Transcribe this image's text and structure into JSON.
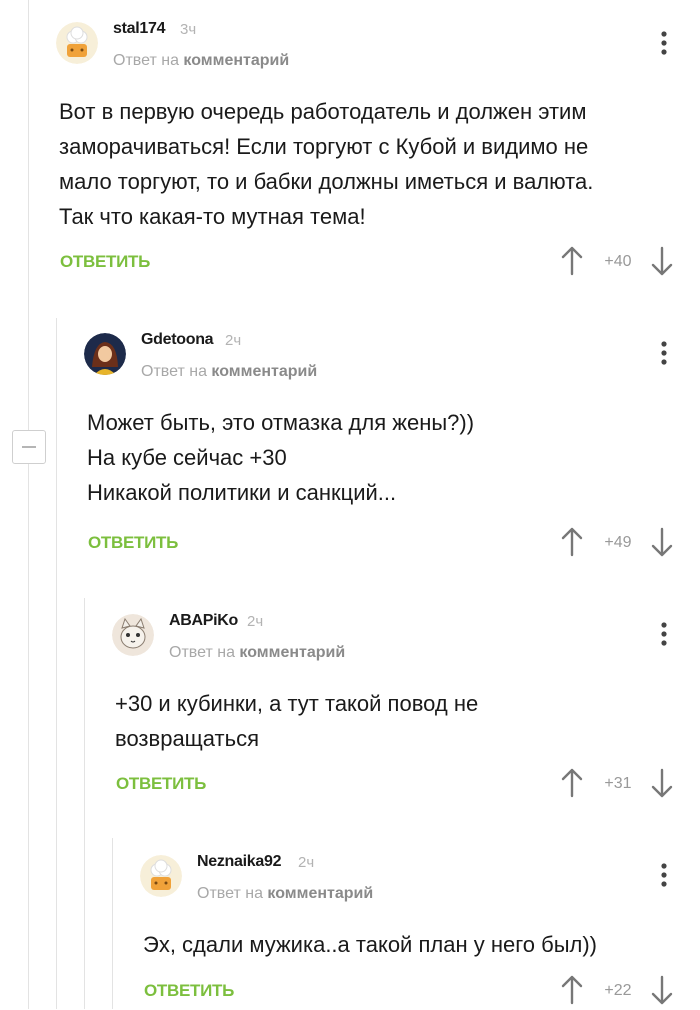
{
  "reply_prefix": "Ответ на",
  "reply_target": "комментарий",
  "comments": [
    {
      "username": "stal174",
      "time": "3ч",
      "avatar": "chef-hat-avatar",
      "lines": [
        "Вот в первую очередь работодатель и должен этим",
        "заморачиваться! Если торгуют с Кубой и видимо не",
        "мало торгуют, то и бабки должны иметься и валюта.",
        "Так что какая-то мутная тема!"
      ],
      "reply_label": "ОТВЕТИТЬ",
      "score": "+40"
    },
    {
      "username": "Gdetoona",
      "time": "2ч",
      "avatar": "princess-avatar",
      "lines": [
        "Может быть, это отмазка для жены?))",
        "На кубе сейчас +30",
        "Никакой политики и санкций..."
      ],
      "reply_label": "ОТВЕТИТЬ",
      "score": "+49"
    },
    {
      "username": "ABAPiKo",
      "time": "2ч",
      "avatar": "cat-avatar",
      "lines": [
        "+30 и кубинки, а тут такой повод не",
        "возвращаться"
      ],
      "reply_label": "ОТВЕТИТЬ",
      "score": "+31"
    },
    {
      "username": "Neznaika92",
      "time": "2ч",
      "avatar": "chef-hat-avatar",
      "lines": [
        "Эх, сдали мужика..а такой план у него был))"
      ],
      "reply_label": "ОТВЕТИТЬ",
      "score": "+22"
    }
  ],
  "colors": {
    "accent": "#7cbf3e",
    "muted": "#a8a8a8",
    "thread_line": "#e3e3e3"
  }
}
